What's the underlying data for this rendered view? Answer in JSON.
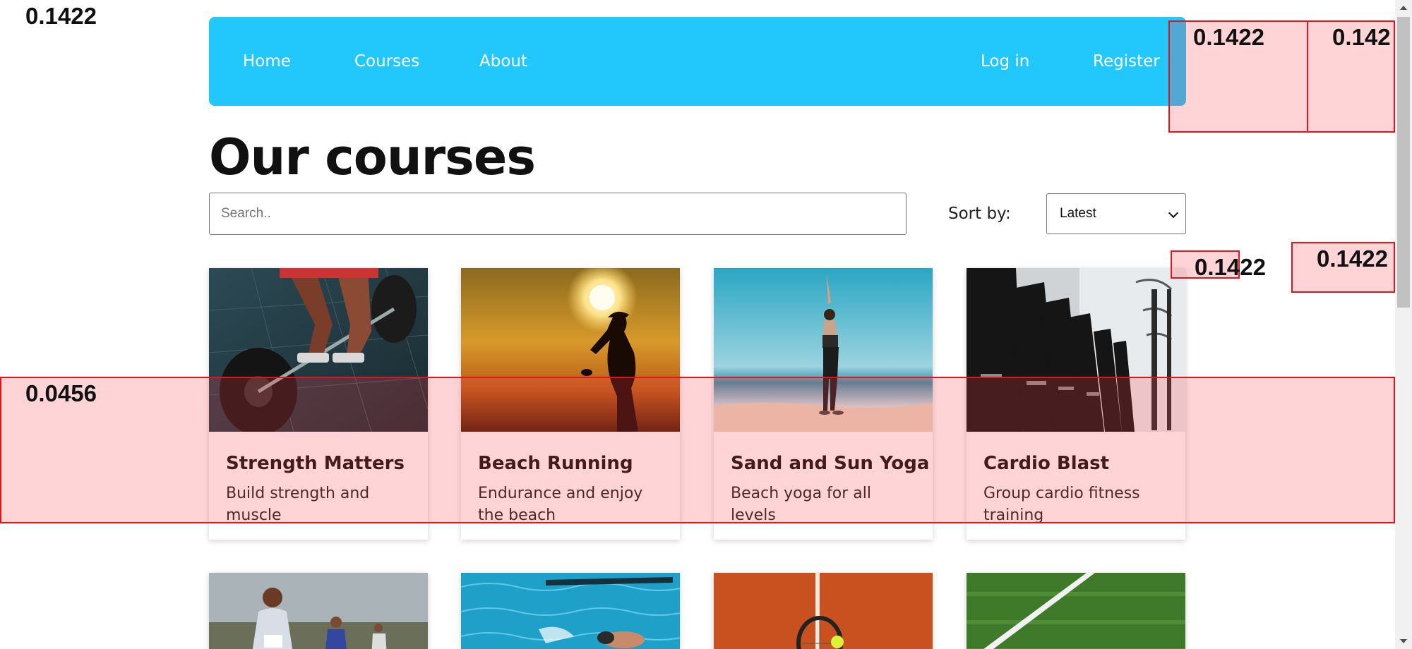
{
  "nav": {
    "home": "Home",
    "courses": "Courses",
    "about": "About",
    "login": "Log in",
    "register": "Register"
  },
  "page_title": "Our courses",
  "search": {
    "placeholder": "Search.."
  },
  "sort": {
    "label": "Sort by:",
    "selected": "Latest"
  },
  "courses": [
    {
      "title": "Strength Matters",
      "description": "Build strength and muscle",
      "image": "barbell-deadlift-photo"
    },
    {
      "title": "Beach Running",
      "description": "Endurance and enjoy the beach",
      "image": "sunset-runner-silhouette-photo"
    },
    {
      "title": "Sand and Sun Yoga",
      "description": "Beach yoga for all levels",
      "image": "beach-yoga-photo"
    },
    {
      "title": "Cardio Blast",
      "description": "Group cardio fitness training",
      "image": "spin-bikes-photo"
    }
  ],
  "more_courses_images": [
    "marathon-runner-photo",
    "swimmer-pool-photo",
    "tennis-clay-court-photo",
    "sports-field-grass-photo"
  ],
  "annotations": {
    "top_left": "0.1422",
    "header_box_1": "0.1422",
    "header_box_2": "0.142",
    "mid_box_1": "0.1422",
    "mid_box_2": "0.1422",
    "card_row": "0.0456"
  },
  "colors": {
    "navbar": "#22c7fb",
    "annotation_border": "#e0161c"
  }
}
